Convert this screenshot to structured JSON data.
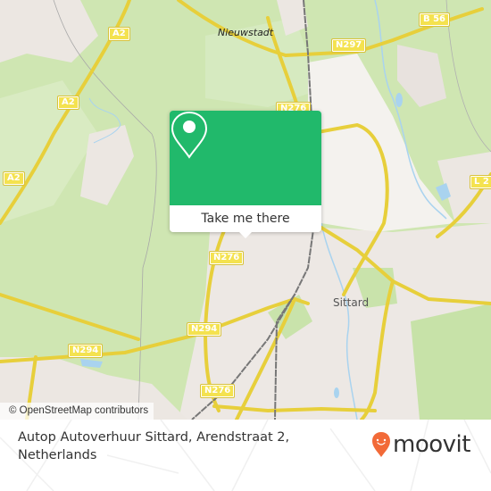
{
  "map": {
    "place_labels": {
      "nieuwstadt": "Nieuwstadt",
      "sittard": "Sittard"
    },
    "road_shields": [
      {
        "id": "a2-top",
        "label": "A2"
      },
      {
        "id": "a2-mid",
        "label": "A2"
      },
      {
        "id": "a2-low",
        "label": "A2"
      },
      {
        "id": "b56",
        "label": "B 56"
      },
      {
        "id": "n297",
        "label": "N297"
      },
      {
        "id": "n276-top",
        "label": "N276"
      },
      {
        "id": "l2",
        "label": "L 2"
      },
      {
        "id": "n276-mid",
        "label": "N276"
      },
      {
        "id": "n294-right",
        "label": "N294"
      },
      {
        "id": "n294-left",
        "label": "N294"
      },
      {
        "id": "n276-low",
        "label": "N276"
      },
      {
        "id": "n276-bottom",
        "label": "N276"
      }
    ],
    "attribution": "© OpenStreetMap contributors",
    "colors": {
      "forest": "#cfe6b2",
      "urban": "#ede8e4",
      "road": "#f4e24f",
      "water": "#a9d3ef",
      "rail": "#777777"
    }
  },
  "popup": {
    "icon": "map-pin-icon",
    "button_label": "Take me there",
    "accent_color": "#21b96b"
  },
  "footer": {
    "address_line1": "Autop Autoverhuur Sittard, Arendstraat 2,",
    "address_line2": "Netherlands",
    "brand": {
      "name": "moovit",
      "icon": "moovit-pin-logo-icon",
      "color": "#f26a38"
    }
  }
}
